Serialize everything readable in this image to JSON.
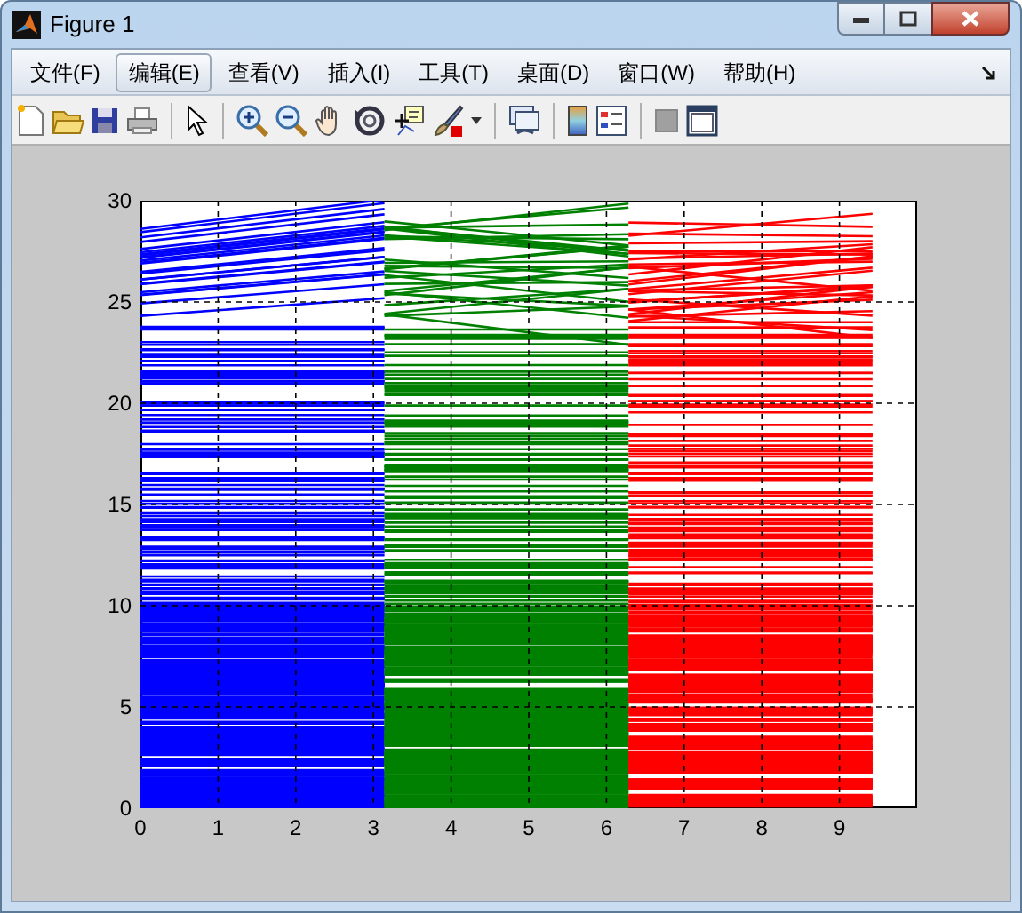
{
  "window": {
    "title": "Figure 1"
  },
  "menu": [
    {
      "label": "文件(F)",
      "selected": false
    },
    {
      "label": "编辑(E)",
      "selected": true
    },
    {
      "label": "查看(V)",
      "selected": false
    },
    {
      "label": "插入(I)",
      "selected": false
    },
    {
      "label": "工具(T)",
      "selected": false
    },
    {
      "label": "桌面(D)",
      "selected": false
    },
    {
      "label": "窗口(W)",
      "selected": false
    },
    {
      "label": "帮助(H)",
      "selected": false
    }
  ],
  "axes": {
    "xticks": [
      "0",
      "1",
      "2",
      "3",
      "4",
      "5",
      "6",
      "7",
      "8",
      "9"
    ],
    "yticks": [
      "30",
      "25",
      "20",
      "15",
      "10",
      "5",
      "0"
    ]
  }
}
